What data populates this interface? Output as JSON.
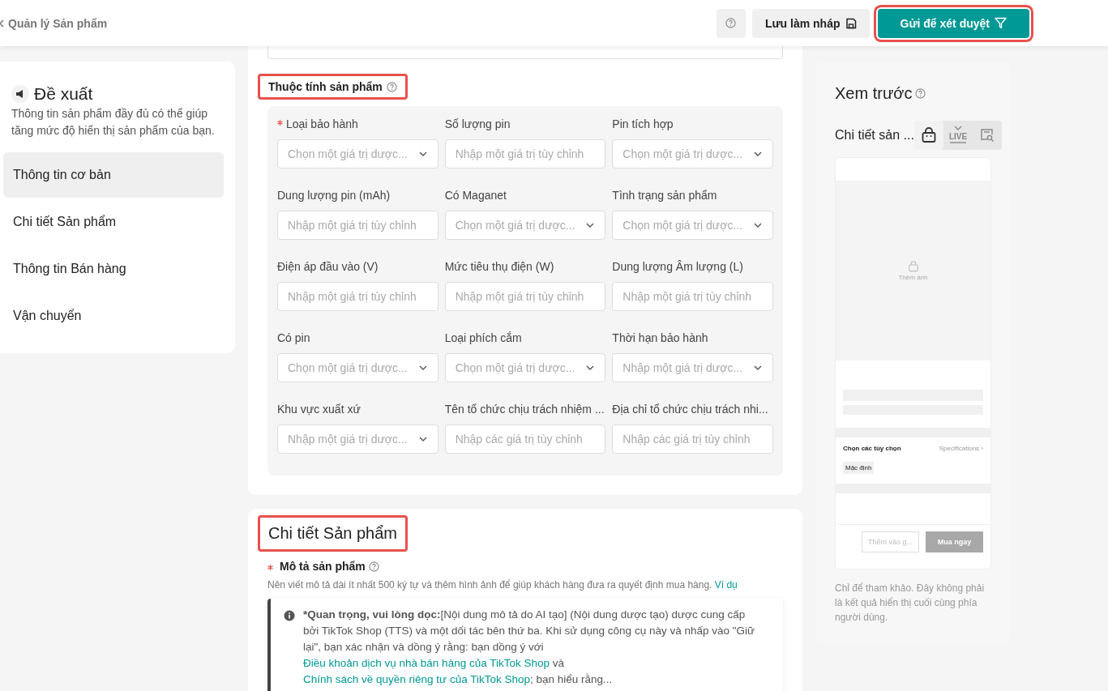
{
  "header": {
    "back_label": "Quản lý Sản phẩm",
    "draft_button": "Lưu làm nháp",
    "submit_button": {
      "label": "Gửi để xét duyệt",
      "highlighted": true
    }
  },
  "sidebar": {
    "title": "Đề xuất",
    "description": "Thông tin sản phẩm đầy đủ có thể giúp tăng mức độ hiển thị sản phẩm của bạn.",
    "items": [
      {
        "label": "Thông tin cơ bản",
        "selected": true
      },
      {
        "label": "Chi tiết Sản phẩm",
        "selected": false
      },
      {
        "label": "Thông tin Bán hàng",
        "selected": false
      },
      {
        "label": "Vận chuyển",
        "selected": false
      }
    ]
  },
  "attributes": {
    "title": "Thuộc tính sản phẩm",
    "highlighted": true,
    "fields": [
      {
        "label": "Loại bảo hành",
        "required": true,
        "kind": "select",
        "placeholder": "Chọn một giá trị dược..."
      },
      {
        "label": "Số lượng pin",
        "required": false,
        "kind": "input",
        "placeholder": "Nhập một giá trị tùy chỉnh"
      },
      {
        "label": "Pin tích hợp",
        "required": false,
        "kind": "select",
        "placeholder": "Chọn một giá trị dược..."
      },
      {
        "label": "Dung lượng pin (mAh)",
        "required": false,
        "kind": "input",
        "placeholder": "Nhập một giá trị tùy chỉnh"
      },
      {
        "label": "Có Maganet",
        "required": false,
        "kind": "select",
        "placeholder": "Chọn một giá trị dược..."
      },
      {
        "label": "Tình trạng sản phẩm",
        "required": false,
        "kind": "select",
        "placeholder": "Chọn một giá trị dược..."
      },
      {
        "label": "Điện áp đầu vào (V)",
        "required": false,
        "kind": "input",
        "placeholder": "Nhập một giá trị tùy chỉnh"
      },
      {
        "label": "Mức tiêu thụ điện (W)",
        "required": false,
        "kind": "input",
        "placeholder": "Nhập một giá trị tùy chỉnh"
      },
      {
        "label": "Dung lượng Âm lượng (L)",
        "required": false,
        "kind": "input",
        "placeholder": "Nhập một giá trị tùy chỉnh"
      },
      {
        "label": "Có pin",
        "required": false,
        "kind": "select",
        "placeholder": "Chọn một giá trị dược..."
      },
      {
        "label": "Loại phích cắm",
        "required": false,
        "kind": "select",
        "placeholder": "Chọn một giá trị dược..."
      },
      {
        "label": "Thời hạn bảo hành",
        "required": false,
        "kind": "select",
        "placeholder": "Nhập một giá trị dược..."
      },
      {
        "label": "Khu vực xuất xứ",
        "required": false,
        "kind": "select",
        "placeholder": "Nhập một giá trị dược..."
      },
      {
        "label": "Tên tổ chức chịu trách nhiệm ...",
        "required": false,
        "kind": "input",
        "placeholder": "Nhập các giá trị tùy chỉnh"
      },
      {
        "label": "Địa chỉ tổ chức chịu trách nhi...",
        "required": false,
        "kind": "input",
        "placeholder": "Nhập các giá trị tùy chỉnh"
      }
    ]
  },
  "details": {
    "title": "Chi tiết Sản phẩm",
    "highlighted": true,
    "description_label": "Mô tả sản phẩm",
    "required": true,
    "hint": "Nên viết mô tả dài ít nhất 500 ký tự và thêm hình ảnh để giúp khách hàng đưa ra quyết định mua hàng.",
    "hint_link": "Ví dụ",
    "notice": [
      {
        "kind": "bold",
        "text": "*Quan trọng, vui lòng dọc:"
      },
      {
        "kind": "text",
        "text": "[Nội dung mô tả do AI tạo] (Nội dung dược tạo) dược cung cấp bởi TikTok Shop (TTS) và một dối tác bên thứ ba. Khi sử dụng công cụ này và nhấp vào \"Giữ lại\", bạn xác nhận và dồng ý rằng: bạn dồng ý với "
      },
      {
        "kind": "link",
        "text": "Điều khoản dịch vụ nhà bán hàng của TikTok Shop"
      },
      {
        "kind": "text",
        "text": " và "
      },
      {
        "kind": "link",
        "text": "Chính sách về quyền riêng tư của TikTok Shop"
      },
      {
        "kind": "text",
        "text": "; bạn hiểu rằng..."
      }
    ]
  },
  "preview": {
    "title": "Xem trước",
    "subtitle": "Chi tiết sản ...",
    "tabs": [
      {
        "kind": "shop",
        "selected": true
      },
      {
        "kind": "live",
        "label": "LIVE",
        "selected": false
      },
      {
        "kind": "search",
        "selected": false
      }
    ],
    "image_label": "Thêm ảnh",
    "options_label": "Chọn các tùy chọn",
    "specs_link": "Specifications ›",
    "option_chip": "Mặc định",
    "cart_button": "Thêm vào g...",
    "buy_button": "Mua ngay",
    "note": "Chỉ để tham khảo. Đây không phải là kết quả hiển thị cuối cùng phía người dùng."
  }
}
